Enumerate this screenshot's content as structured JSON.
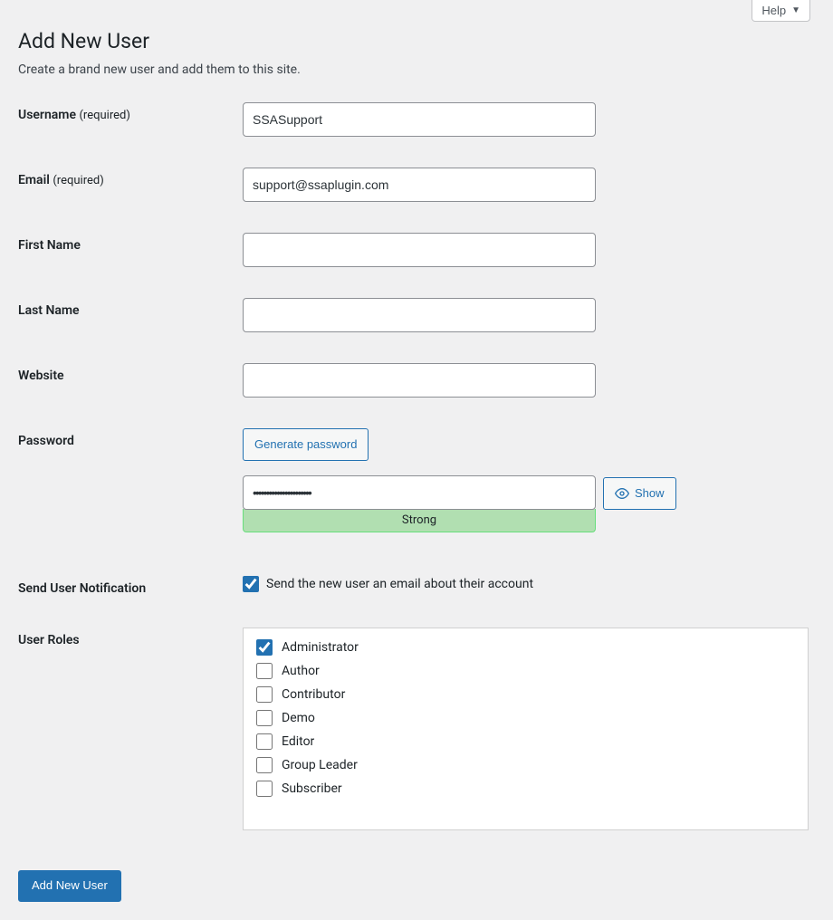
{
  "help": {
    "label": "Help"
  },
  "page": {
    "title": "Add New User",
    "subtitle": "Create a brand new user and add them to this site."
  },
  "fields": {
    "username": {
      "label": "Username",
      "req": "(required)",
      "value": "SSASupport"
    },
    "email": {
      "label": "Email",
      "req": "(required)",
      "value": "support@ssaplugin.com"
    },
    "first": {
      "label": "First Name",
      "value": ""
    },
    "last": {
      "label": "Last Name",
      "value": ""
    },
    "website": {
      "label": "Website",
      "value": ""
    },
    "password": {
      "label": "Password",
      "generate": "Generate password",
      "value": "••••••••••••••••••••••",
      "strength": "Strong",
      "show": "Show"
    },
    "notify": {
      "label": "Send User Notification",
      "checkbox_label": "Send the new user an email about their account",
      "checked": true
    },
    "roles": {
      "label": "User Roles",
      "items": [
        {
          "name": "Administrator",
          "checked": true
        },
        {
          "name": "Author",
          "checked": false
        },
        {
          "name": "Contributor",
          "checked": false
        },
        {
          "name": "Demo",
          "checked": false
        },
        {
          "name": "Editor",
          "checked": false
        },
        {
          "name": "Group Leader",
          "checked": false
        },
        {
          "name": "Subscriber",
          "checked": false
        }
      ]
    }
  },
  "submit": {
    "label": "Add New User"
  }
}
